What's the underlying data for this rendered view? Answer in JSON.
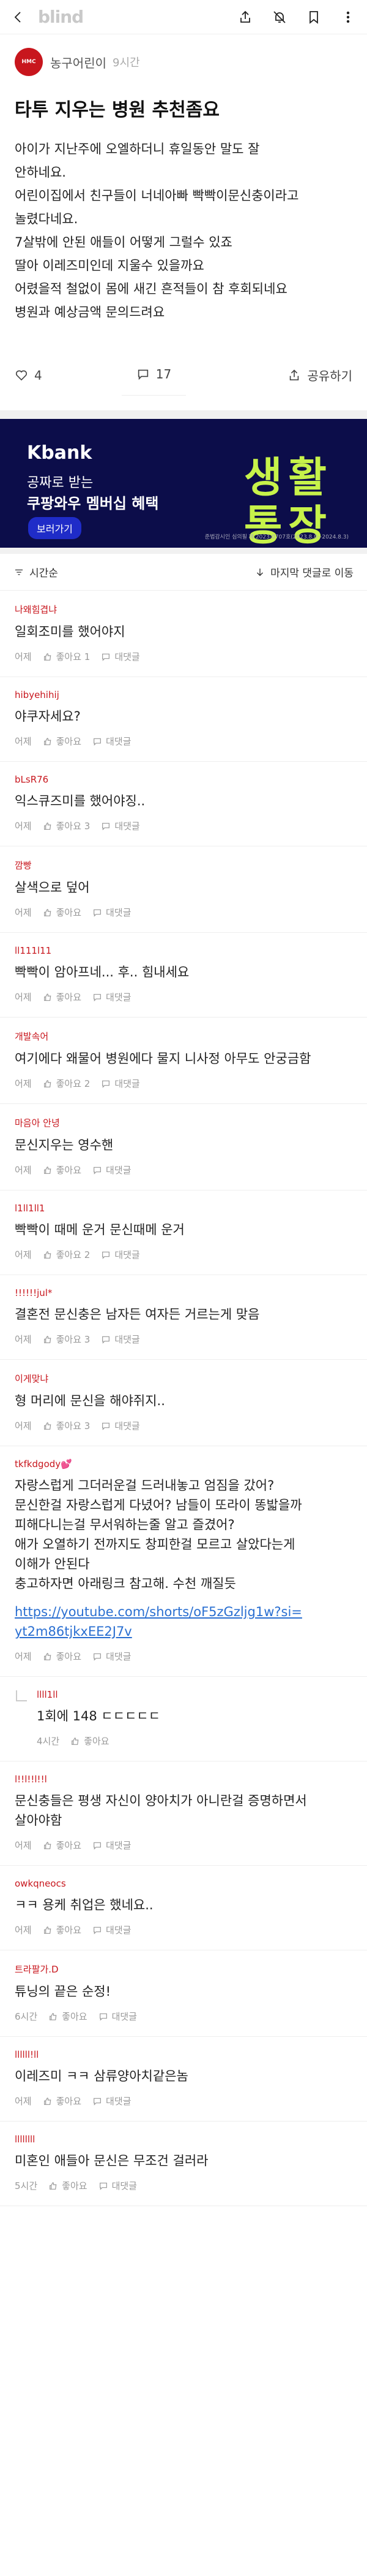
{
  "topbar": {
    "brand": "blind",
    "back_icon": "back-arrow-icon",
    "share_icon": "share-icon",
    "mute_icon": "bell-off-icon",
    "bookmark_icon": "bookmark-icon",
    "more_icon": "more-icon"
  },
  "author": {
    "avatar_text": "HMC",
    "name": "농구어린이",
    "time": "9시간"
  },
  "post": {
    "title": "타투 지우는 병원 추천좀요",
    "lines": [
      "아이가 지난주에 오엘하더니 휴일동안 말도 잘",
      "안하네요.",
      "어린이집에서 친구들이 너네아빠 빡빡이문신충이라고",
      "놀렸다네요.",
      "7살밖에 안된 애들이 어떻게 그럴수 있죠",
      "딸아 이레즈미인데 지울수 있을까요",
      "어렸을적 철없이 몸에 새긴 흔적들이 참 후회되네요",
      "병원과 예상금액 문의드려요"
    ],
    "likes": "4",
    "comments": "17",
    "share_label": "공유하기"
  },
  "ad": {
    "brand": "Kbank",
    "line1": "공짜로 받는",
    "line2": "쿠팡와우 멤버십 혜택",
    "button": "보러가기",
    "big1": "생활",
    "big2": "통장",
    "fine": "준법감시인 심의필 제 2023-0707호(2023.8.0~2024.8.3)",
    "colors": {
      "bg": "#0c0d4a",
      "accent": "#c7f24a",
      "button": "#1f2cc8"
    }
  },
  "sort": {
    "left_label": "시간순",
    "right_label": "마지막 댓글로 이동"
  },
  "comments": [
    {
      "author": "나왜힘겹냐",
      "text": [
        "일회조미를 했어야지"
      ],
      "time": "어제",
      "likes": "좋아요 1",
      "reply": "대댓글"
    },
    {
      "author": "hibyehihij",
      "text": [
        "야쿠자세요?"
      ],
      "time": "어제",
      "likes": "좋아요",
      "reply": "대댓글"
    },
    {
      "author": "bLsR76",
      "text": [
        "익스큐즈미를 했어야징.."
      ],
      "time": "어제",
      "likes": "좋아요 3",
      "reply": "대댓글"
    },
    {
      "author": "깜빵",
      "text": [
        "살색으로 덮어"
      ],
      "time": "어제",
      "likes": "좋아요",
      "reply": "대댓글"
    },
    {
      "author": "ll111l11",
      "text": [
        "빡빡이 암아프네... 후.. 힘내세요"
      ],
      "time": "어제",
      "likes": "좋아요",
      "reply": "대댓글"
    },
    {
      "author": "개발속어",
      "text": [
        "여기에다 왜물어 병원에다 물지 니사정 아무도 안궁금함"
      ],
      "time": "어제",
      "likes": "좋아요 2",
      "reply": "대댓글"
    },
    {
      "author": "마음아 안녕",
      "text": [
        "문신지우는 영수핸"
      ],
      "time": "어제",
      "likes": "좋아요",
      "reply": "대댓글"
    },
    {
      "author": "l1ll1ll1",
      "text": [
        "빡빡이 때메 운거 문신때메 운거"
      ],
      "time": "어제",
      "likes": "좋아요 2",
      "reply": "대댓글"
    },
    {
      "author": "!!!!!!jul*",
      "text": [
        "결혼전 문신충은 남자든 여자든 거르는게 맞음"
      ],
      "time": "어제",
      "likes": "좋아요 3",
      "reply": "대댓글"
    },
    {
      "author": "이게맞냐",
      "text": [
        "형 머리에 문신을 해야쥐지.."
      ],
      "time": "어제",
      "likes": "좋아요 3",
      "reply": "대댓글"
    },
    {
      "author": "tkfkdgody💕",
      "text": [
        "자랑스럽게 그더러운걸 드러내놓고 엄짐을 갔어?",
        "문신한걸 자랑스럽게 다녔어? 남들이 또라이 똥밟을까",
        "피해다니는걸 무서워하는줄 알고 즐겼어?",
        "애가 오열하기 전까지도 창피한걸 모르고 살았다는게",
        "이해가 안된다",
        "충고하자면 아래링크 참고해. 수천 깨질듯"
      ],
      "link": [
        "https://youtube.com/shorts/oF5zGzljg1w?si=",
        "yt2m86tjkxEE2J7v"
      ],
      "time": "어제",
      "likes": "좋아요",
      "reply": "대댓글"
    },
    {
      "author": "llll1ll",
      "text": [
        "1회에 148 ㄷㄷㄷㄷㄷ"
      ],
      "time": "4시간",
      "likes": "좋아요",
      "reply": "",
      "is_reply": true
    },
    {
      "author": "l!!l!!l!!l",
      "text": [
        "문신충들은 평생 자신이 양아치가 아니란걸 증명하면서",
        "살아야함"
      ],
      "time": "어제",
      "likes": "좋아요",
      "reply": "대댓글"
    },
    {
      "author": "owkqneocs",
      "text": [
        "ㅋㅋ 용케 취업은 했네요.."
      ],
      "time": "어제",
      "likes": "좋아요",
      "reply": "대댓글"
    },
    {
      "author": "트라팔가.D",
      "text": [
        "튜닝의 끝은 순정!"
      ],
      "time": "6시간",
      "likes": "좋아요",
      "reply": "대댓글"
    },
    {
      "author": "llllll!ll",
      "text": [
        "이레즈미 ㅋㅋ 삼류양아치같은놈"
      ],
      "time": "어제",
      "likes": "좋아요",
      "reply": "대댓글"
    },
    {
      "author": "llllllll",
      "text": [
        "미혼인 애들아 문신은 무조건 걸러라"
      ],
      "time": "5시간",
      "likes": "좋아요",
      "reply": "대댓글"
    }
  ]
}
